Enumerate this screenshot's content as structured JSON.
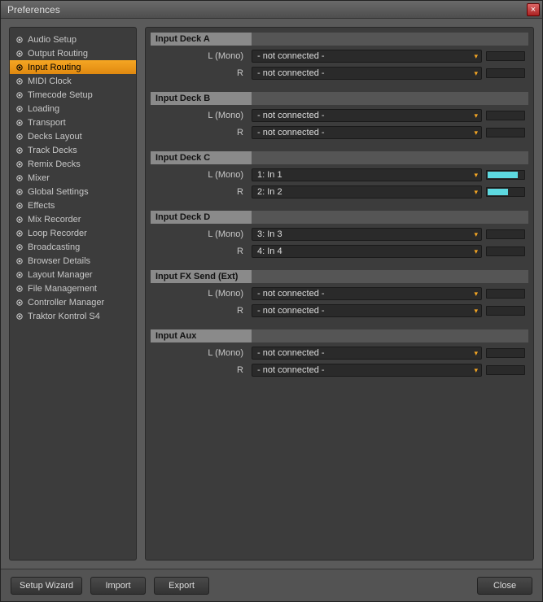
{
  "window": {
    "title": "Preferences",
    "close_glyph": "×"
  },
  "sidebar": {
    "items": [
      {
        "label": "Audio Setup",
        "selected": false
      },
      {
        "label": "Output Routing",
        "selected": false
      },
      {
        "label": "Input Routing",
        "selected": true
      },
      {
        "label": "MIDI Clock",
        "selected": false
      },
      {
        "label": "Timecode Setup",
        "selected": false
      },
      {
        "label": "Loading",
        "selected": false
      },
      {
        "label": "Transport",
        "selected": false
      },
      {
        "label": "Decks Layout",
        "selected": false
      },
      {
        "label": "Track Decks",
        "selected": false
      },
      {
        "label": "Remix Decks",
        "selected": false
      },
      {
        "label": "Mixer",
        "selected": false
      },
      {
        "label": "Global Settings",
        "selected": false
      },
      {
        "label": "Effects",
        "selected": false
      },
      {
        "label": "Mix Recorder",
        "selected": false
      },
      {
        "label": "Loop Recorder",
        "selected": false
      },
      {
        "label": "Broadcasting",
        "selected": false
      },
      {
        "label": "Browser Details",
        "selected": false
      },
      {
        "label": "Layout Manager",
        "selected": false
      },
      {
        "label": "File Management",
        "selected": false
      },
      {
        "label": "Controller Manager",
        "selected": false
      },
      {
        "label": "Traktor Kontrol S4",
        "selected": false
      }
    ]
  },
  "sections": [
    {
      "title": "Input Deck A",
      "rows": [
        {
          "label": "L (Mono)",
          "value": "- not connected -",
          "meter": 0
        },
        {
          "label": "R",
          "value": "- not connected -",
          "meter": 0
        }
      ]
    },
    {
      "title": "Input Deck B",
      "rows": [
        {
          "label": "L (Mono)",
          "value": "- not connected -",
          "meter": 0
        },
        {
          "label": "R",
          "value": "- not connected -",
          "meter": 0
        }
      ]
    },
    {
      "title": "Input Deck C",
      "rows": [
        {
          "label": "L (Mono)",
          "value": "1: In 1",
          "meter": 80
        },
        {
          "label": "R",
          "value": "2: In 2",
          "meter": 55
        }
      ]
    },
    {
      "title": "Input Deck D",
      "rows": [
        {
          "label": "L (Mono)",
          "value": "3: In 3",
          "meter": 0
        },
        {
          "label": "R",
          "value": "4: In 4",
          "meter": 0
        }
      ]
    },
    {
      "title": "Input FX Send (Ext)",
      "rows": [
        {
          "label": "L (Mono)",
          "value": "- not connected -",
          "meter": 0
        },
        {
          "label": "R",
          "value": "- not connected -",
          "meter": 0
        }
      ]
    },
    {
      "title": "Input Aux",
      "rows": [
        {
          "label": "L (Mono)",
          "value": "- not connected -",
          "meter": 0
        },
        {
          "label": "R",
          "value": "- not connected -",
          "meter": 0
        }
      ]
    }
  ],
  "footer": {
    "setup_wizard": "Setup Wizard",
    "import": "Import",
    "export": "Export",
    "close": "Close"
  },
  "colors": {
    "accent": "#f5a623",
    "meter_fill": "#5dd9e0"
  }
}
